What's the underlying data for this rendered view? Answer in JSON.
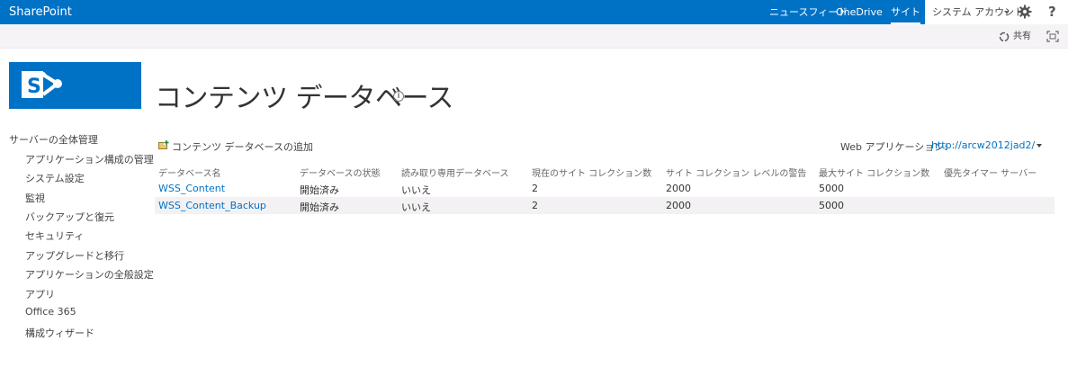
{
  "suite": {
    "brand": "SharePoint",
    "nav": [
      "ニュースフィード",
      "OneDrive",
      "サイト"
    ],
    "account": "システム アカウント"
  },
  "ribbon": {
    "share_label": "共有"
  },
  "page": {
    "title": "コンテンツ データベース",
    "info_glyph": "i"
  },
  "leftnav": {
    "heading": "サーバーの全体管理",
    "items": [
      "アプリケーション構成の管理",
      "システム設定",
      "監視",
      "バックアップと復元",
      "セキュリティ",
      "アップグレードと移行",
      "アプリケーションの全般設定",
      "アプリ",
      "Office 365",
      "構成ウィザード"
    ]
  },
  "toolbar": {
    "add_db_label": "コンテンツ データベースの追加",
    "webapp_label": "Web アプリケーション:",
    "webapp_value": "http://arcw2012jad2/"
  },
  "table": {
    "columns": [
      "データベース名",
      "データベースの状態",
      "読み取り専用データベース",
      "現在のサイト コレクション数",
      "サイト コレクション レベルの警告",
      "最大サイト コレクション数",
      "優先タイマー サーバー"
    ],
    "rows": [
      [
        "WSS_Content",
        "開始済み",
        "いいえ",
        "2",
        "2000",
        "5000",
        ""
      ],
      [
        "WSS_Content_Backup",
        "開始済み",
        "いいえ",
        "2",
        "2000",
        "5000",
        ""
      ]
    ]
  },
  "colors": {
    "suite_blue": "#0072c6",
    "link_blue": "#0072c6",
    "ribbon_bg": "#f6f3f6"
  }
}
